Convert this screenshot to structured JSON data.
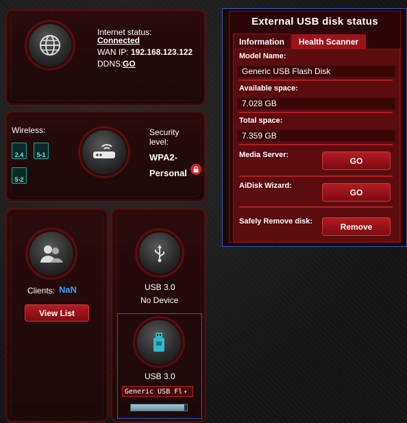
{
  "internet": {
    "status_label": "Internet status:",
    "status_value": "Connected",
    "wan_label": "WAN IP:",
    "wan_value": "192.168.123.122",
    "ddns_label": "DDNS:",
    "ddns_value": "GO"
  },
  "wireless": {
    "label": "Wireless:",
    "bands": [
      "2.4",
      "5-1",
      "5-2"
    ],
    "security_label_1": "Security",
    "security_label_2": "level:",
    "security_value_1": "WPA2-",
    "security_value_2": "Personal"
  },
  "clients": {
    "label": "Clients:",
    "value": "NaN",
    "button": "View List"
  },
  "usb1": {
    "label": "USB 3.0",
    "status": "No Device"
  },
  "usb2": {
    "label": "USB 3.0",
    "selected_device": "Generic USB Fl",
    "progress": 0.95
  },
  "status_panel": {
    "title": "External USB disk status",
    "tabs": [
      "Information",
      "Health Scanner"
    ],
    "model_label": "Model Name:",
    "model_value": "Generic USB Flash Disk",
    "available_label": "Available space:",
    "available_value": "7.028 GB",
    "total_label": "Total space:",
    "total_value": "7.359 GB",
    "media_label": "Media Server:",
    "media_button": "GO",
    "aidisk_label": "AiDisk Wizard:",
    "aidisk_button": "GO",
    "remove_label": "Safely Remove disk:",
    "remove_button": "Remove"
  },
  "colors": {
    "accent_red": "#b21c22",
    "teal": "#1fa89a",
    "link_blue": "#3aa0ff"
  }
}
